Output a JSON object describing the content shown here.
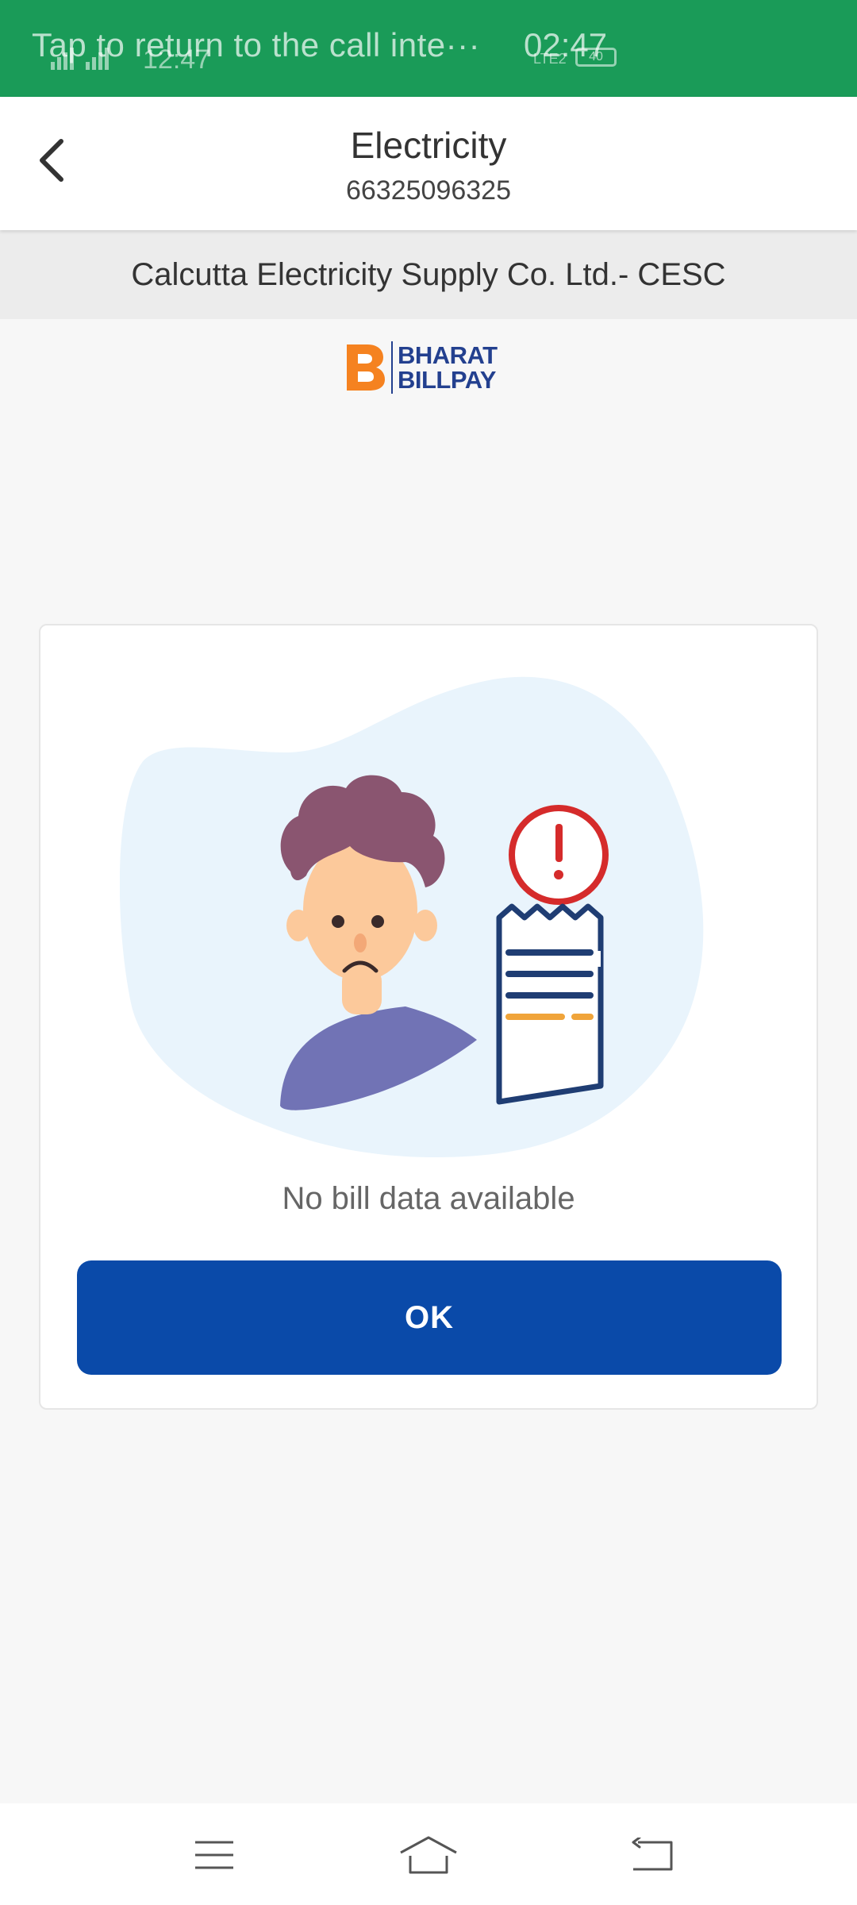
{
  "status_bar": {
    "call_banner_text": "Tap to return to the call inte···",
    "call_timer": "02:47",
    "clock": "12:47",
    "network_label": "LTE2",
    "battery_level": "40"
  },
  "header": {
    "title": "Electricity",
    "account_number": "66325096325",
    "back_icon": "chevron-left-icon"
  },
  "biller": {
    "name": "Calcutta Electricity Supply Co. Ltd.- CESC"
  },
  "logo": {
    "line1": "BHARAT",
    "line2": "BILLPAY",
    "brand_blue": "#23408f",
    "brand_orange": "#f58220"
  },
  "empty_state": {
    "illustration": "sad-person-with-bill-alert-illustration",
    "message": "No bill data available",
    "ok_label": "OK",
    "button_color": "#0a4aa9"
  },
  "navbar": {
    "menu_icon": "menu-icon",
    "home_icon": "home-icon",
    "back_icon": "back-icon"
  },
  "colors": {
    "status_bar": "#1a9b58",
    "background": "#f7f7f7"
  }
}
